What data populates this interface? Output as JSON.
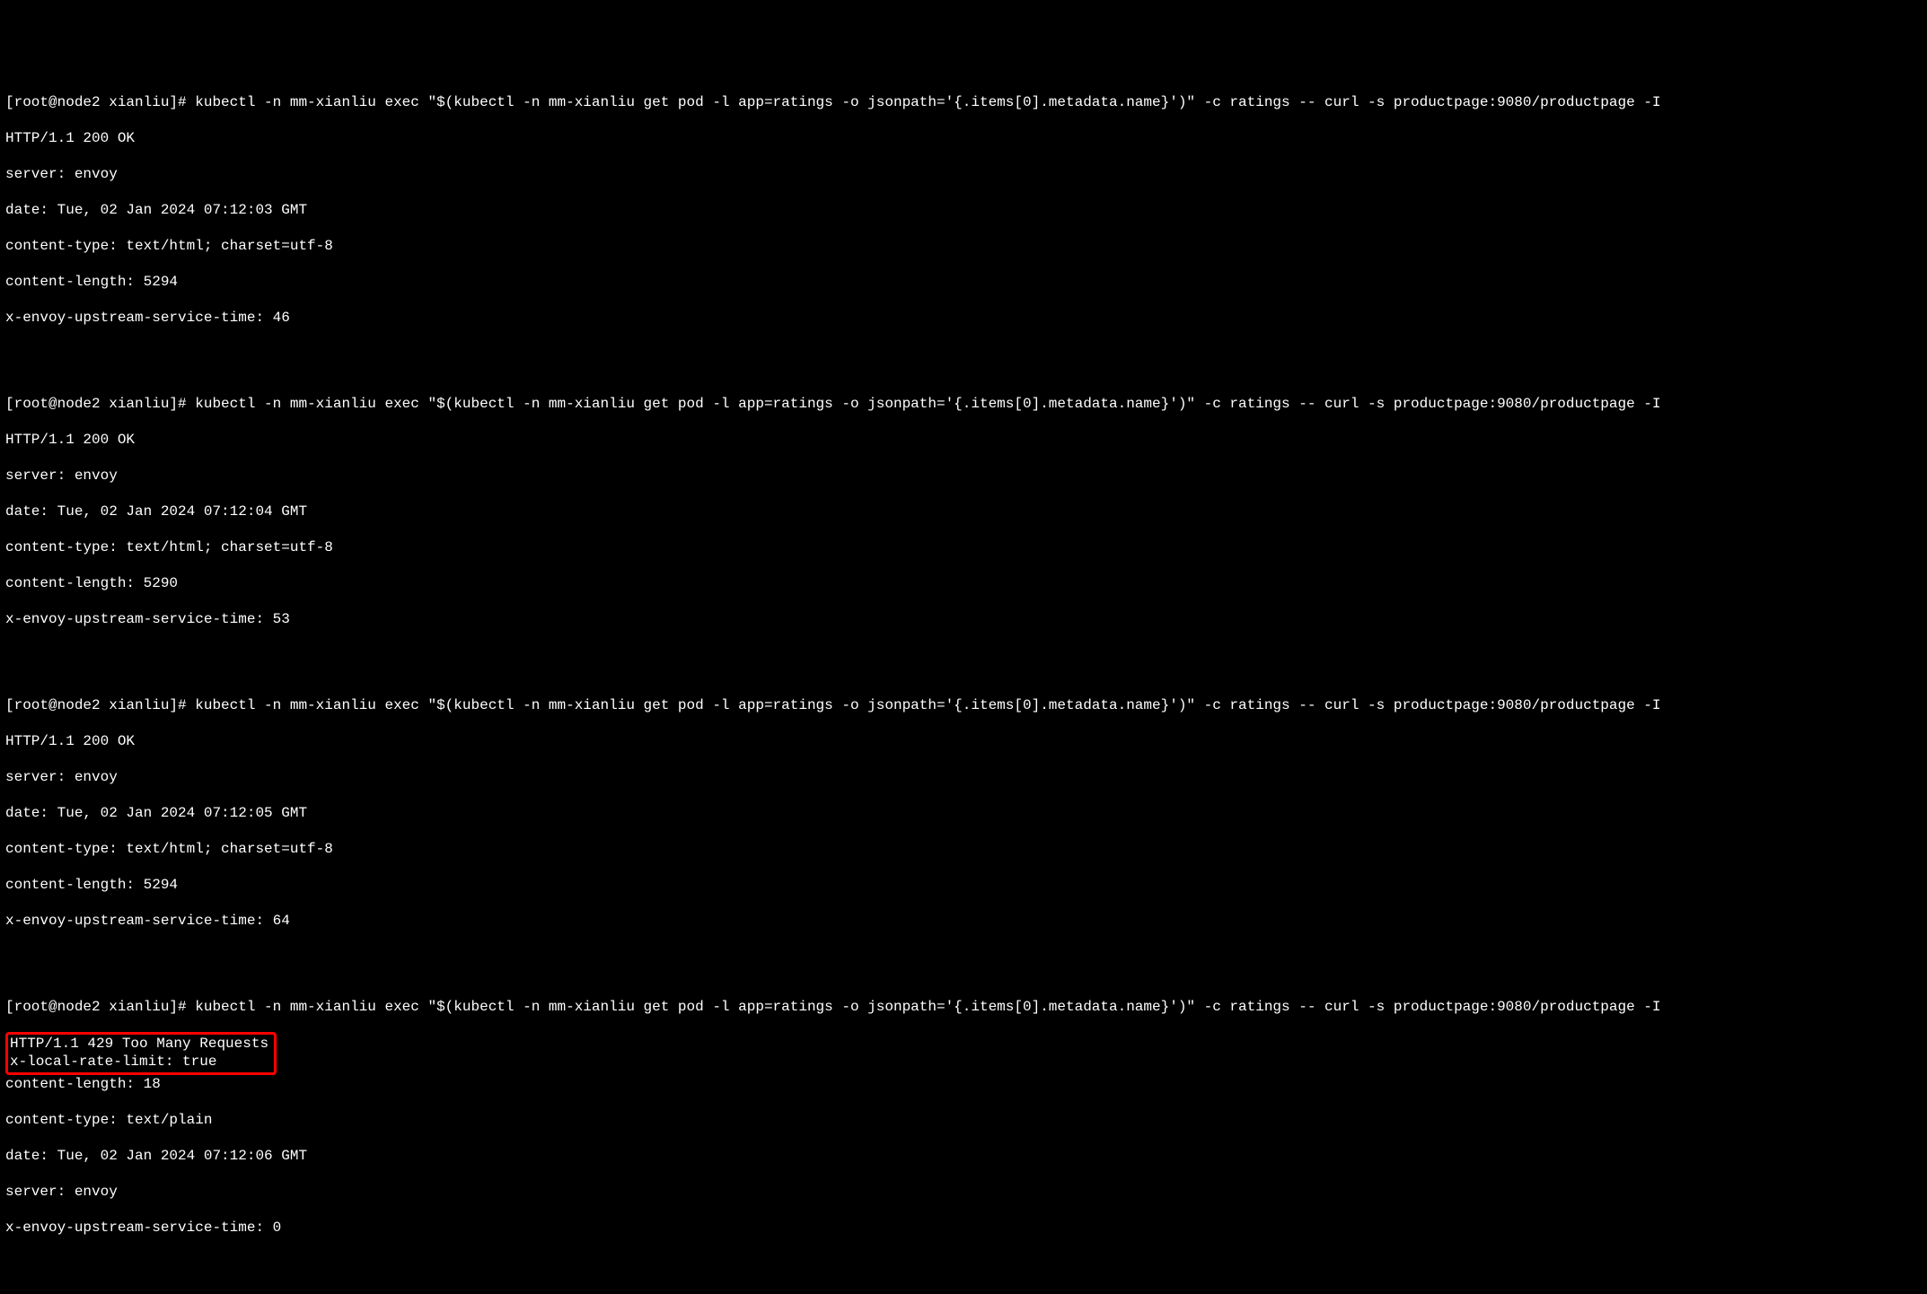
{
  "blocks": [
    {
      "prompt": "[root@node2 xianliu]# kubectl -n mm-xianliu exec \"$(kubectl -n mm-xianliu get pod -l app=ratings -o jsonpath='{.items[0].metadata.name}')\" -c ratings -- curl -s productpage:9080/productpage -I",
      "lines": [
        "HTTP/1.1 200 OK",
        "server: envoy",
        "date: Tue, 02 Jan 2024 07:12:03 GMT",
        "content-type: text/html; charset=utf-8",
        "content-length: 5294",
        "x-envoy-upstream-service-time: 46"
      ]
    },
    {
      "prompt": "[root@node2 xianliu]# kubectl -n mm-xianliu exec \"$(kubectl -n mm-xianliu get pod -l app=ratings -o jsonpath='{.items[0].metadata.name}')\" -c ratings -- curl -s productpage:9080/productpage -I",
      "lines": [
        "HTTP/1.1 200 OK",
        "server: envoy",
        "date: Tue, 02 Jan 2024 07:12:04 GMT",
        "content-type: text/html; charset=utf-8",
        "content-length: 5290",
        "x-envoy-upstream-service-time: 53"
      ]
    },
    {
      "prompt": "[root@node2 xianliu]# kubectl -n mm-xianliu exec \"$(kubectl -n mm-xianliu get pod -l app=ratings -o jsonpath='{.items[0].metadata.name}')\" -c ratings -- curl -s productpage:9080/productpage -I",
      "lines": [
        "HTTP/1.1 200 OK",
        "server: envoy",
        "date: Tue, 02 Jan 2024 07:12:05 GMT",
        "content-type: text/html; charset=utf-8",
        "content-length: 5294",
        "x-envoy-upstream-service-time: 64"
      ]
    },
    {
      "prompt": "[root@node2 xianliu]# kubectl -n mm-xianliu exec \"$(kubectl -n mm-xianliu get pod -l app=ratings -o jsonpath='{.items[0].metadata.name}')\" -c ratings -- curl -s productpage:9080/productpage -I",
      "highlighted": {
        "line1": "HTTP/1.1 429 Too Many Requests",
        "line2": "x-local-rate-limit: true"
      },
      "lines": [
        "content-length: 18",
        "content-type: text/plain",
        "date: Tue, 02 Jan 2024 07:12:06 GMT",
        "server: envoy",
        "x-envoy-upstream-service-time: 0"
      ]
    }
  ]
}
